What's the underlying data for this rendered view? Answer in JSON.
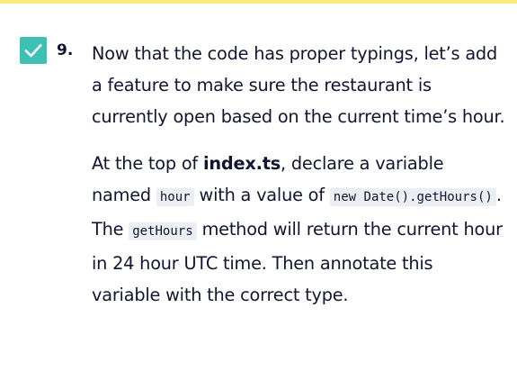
{
  "theme": {
    "top_bar_color": "#fde978",
    "checkbox_color": "#3cc1b5",
    "checkmark_color": "#ffffff",
    "text_color": "#10162f",
    "code_bg_color": "#ebeef3"
  },
  "task": {
    "checked": true,
    "checkbox_icon": "checkmark-icon",
    "number": "9.",
    "paragraph1": "Now that the code has proper typings, let’s add a feature to make sure the restaurant is currently open based on the current time’s hour.",
    "paragraph2": {
      "text1": "At the top of ",
      "file": "index.ts",
      "text2": ", declare a variable named ",
      "code1": "hour",
      "text3": " with a value of ",
      "code2": "new Date().getHours()",
      "text4": ". The ",
      "code3": "getHours",
      "text5": " method will return the current hour in 24 hour UTC time. Then annotate this variable with the correct type."
    }
  }
}
